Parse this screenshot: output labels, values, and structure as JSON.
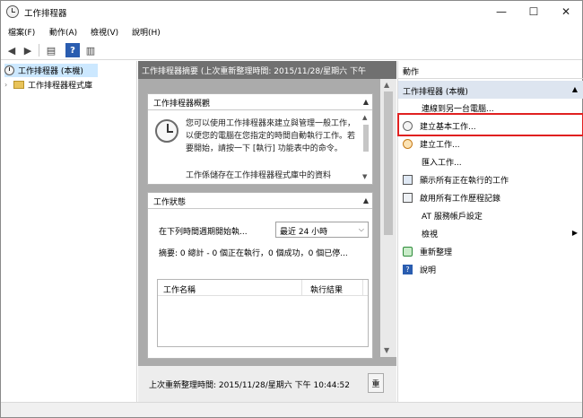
{
  "window": {
    "title": "工作排程器",
    "minimize": "—",
    "maximize": "☐",
    "close": "✕"
  },
  "menu": [
    "檔案(F)",
    "動作(A)",
    "檢視(V)",
    "說明(H)"
  ],
  "toolbar": {
    "back": "◀",
    "forward": "▶",
    "show_tree": "▤",
    "help": "?",
    "view": "▥"
  },
  "tree": {
    "root": "工作排程器 (本機)",
    "library": "工作排程器程式庫",
    "expander": "›"
  },
  "center": {
    "header": "工作排程器摘要 (上次重新整理時間: 2015/11/28/星期六 下午",
    "overview": {
      "title": "工作排程器概觀",
      "text": "您可以使用工作排程器來建立與管理一般工作，以便您的電腦在您指定的時間自動執行工作。若要開始，請按一下 [執行] 功能表中的命令。",
      "text2": "工作係儲存在工作排程器程式庫中的資料"
    },
    "status": {
      "title": "工作狀態",
      "prompt": "在下列時間週期開始執...",
      "period": "最近 24 小時",
      "summary": "摘要: 0 總計 - 0 個正在執行，0 個成功，0 個已停...",
      "columns": [
        "工作名稱",
        "執行結果"
      ]
    },
    "last_refresh": "上次重新整理時間: 2015/11/28/星期六 下午 10:44:52",
    "refresh_button": "重"
  },
  "actions": {
    "header": "動作",
    "subheader": "工作排程器 (本機)",
    "items": [
      {
        "label": "連線到另一台電腦...",
        "icon": "none"
      },
      {
        "label": "建立基本工作...",
        "icon": "create-basic-task-icon"
      },
      {
        "label": "建立工作...",
        "icon": "create-task-icon"
      },
      {
        "label": "匯入工作...",
        "icon": "none"
      },
      {
        "label": "顯示所有正在執行的工作",
        "icon": "running-tasks-icon"
      },
      {
        "label": "啟用所有工作歷程記錄",
        "icon": "history-icon"
      },
      {
        "label": "AT 服務帳戶設定",
        "icon": "none"
      },
      {
        "label": "檢視",
        "icon": "none"
      },
      {
        "label": "重新整理",
        "icon": "refresh-icon"
      },
      {
        "label": "說明",
        "icon": "help-icon"
      }
    ]
  },
  "colors": {
    "highlight": "#e02020",
    "selection": "#cce8ff",
    "pane_header": "#707070"
  }
}
